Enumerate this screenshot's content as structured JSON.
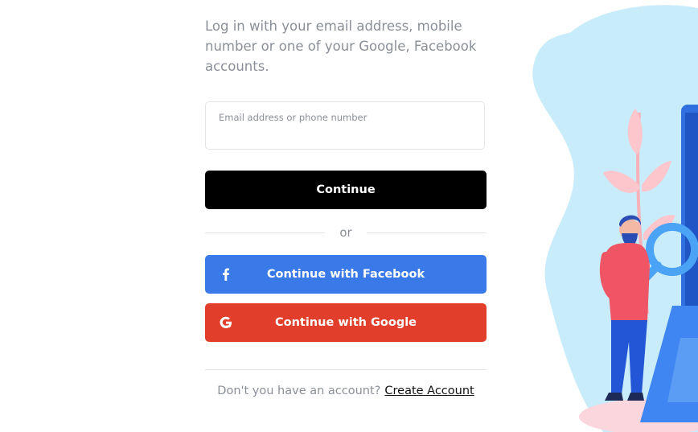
{
  "intro_text": "Log in with your email address, mobile number or one of your Google, Facebook accounts.",
  "email_field": {
    "label": "Email address or phone number",
    "value": ""
  },
  "continue_button": "Continue",
  "divider_text": "or",
  "facebook_button": {
    "label": "Continue with Facebook",
    "icon": "facebook-icon",
    "color": "#3a7ae8"
  },
  "google_button": {
    "label": "Continue with Google",
    "icon": "google-icon",
    "color": "#e13e2b"
  },
  "footer": {
    "prompt": "Don't you have an account?",
    "link": "Create Account"
  },
  "colors": {
    "text_muted": "#8a8f98",
    "continue_bg": "#000000",
    "blob": "#c9ecfa",
    "leaf": "#fcc6cc",
    "device_blue": "#2f6fe0"
  }
}
